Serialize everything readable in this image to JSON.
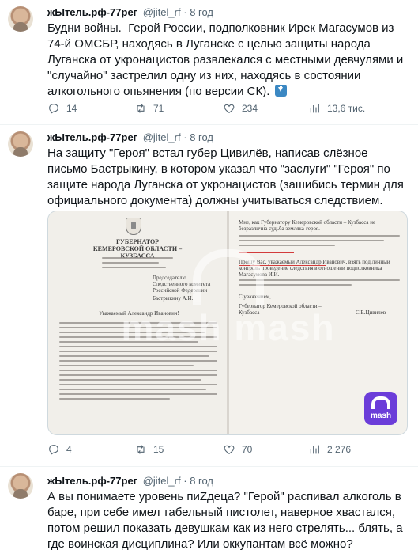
{
  "tweets": [
    {
      "name": "жЫтель.рф-77рег",
      "handle": "@jitel_rf",
      "dot": "·",
      "time": "8 год",
      "text": "Будни войны.  Герой России, подполковник Ирек Магасумов из 74-й ОМСБР, находясь в Луганске с целью защиты народа Луганска от укронацистов развлекался с местными девчулями и \"случайно\" застрелил одну из них, находясь в состоянии алкогольного опьянения (по версии СК).",
      "replies": "14",
      "reposts": "71",
      "likes": "234",
      "views": "13,6 тис."
    },
    {
      "name": "жЫтель.рф-77рег",
      "handle": "@jitel_rf",
      "dot": "·",
      "time": "8 год",
      "text": "На защиту \"Героя\" встал губер Цивилёв, написав слёзное письмо Бастрыкину, в котором указал что \"заслуги\" \"Героя\" по защите народа Луганска от укронацистов (зашибись термин для официального документа) должны учитываться следствием.",
      "replies": "4",
      "reposts": "15",
      "likes": "70",
      "views": "2 276"
    },
    {
      "name": "жЫтель.рф-77рег",
      "handle": "@jitel_rf",
      "dot": "·",
      "time": "8 год",
      "text": "А вы понимаете уровень пиZдеца? \"Герой\" распивал алкоголь в баре, при себе имел табельный пистолет, наверное хвастался,  потом решил показать девушкам как из него стрелять... блять, а где воинская дисциплина? Или оккупантам всё можно?"
    }
  ],
  "media": {
    "left_doc": {
      "org_line1": "ГУБЕРНАТОР",
      "org_line2": "КЕМЕРОВСКОЙ ОБЛАСТИ – КУЗБАССА",
      "recipient": "Председателю Следственного комитета Российской Федерации",
      "recipient_name": "Бастрыкину А.И.",
      "greeting": "Уважаемый Александр Иванович!"
    },
    "right_doc": {
      "intro": "Мне, как Губернатору Кемеровской области – Кузбасса не безразлична судьба земляка-героя.",
      "request": "Прошу Вас, уважаемый Александр Иванович, взять под личный контроль проведение следствия в отношении подполковника Магасумова И.И.",
      "closing": "С уважением,",
      "signer_title": "Губернатор Кемеровской области – Кузбасса",
      "signer_name": "С.Е.Цивилев"
    },
    "watermark": "mash mash",
    "logo_text": "mash"
  },
  "icons": {
    "reply": "reply-icon",
    "repost": "repost-icon",
    "like": "heart-icon",
    "views": "views-icon",
    "down_arrow_emoji": "down-arrow-emoji"
  },
  "colors": {
    "text": "#0f1419",
    "secondary": "#536471",
    "divider": "#eff3f4",
    "mash_purple": "#6b3dd9"
  }
}
